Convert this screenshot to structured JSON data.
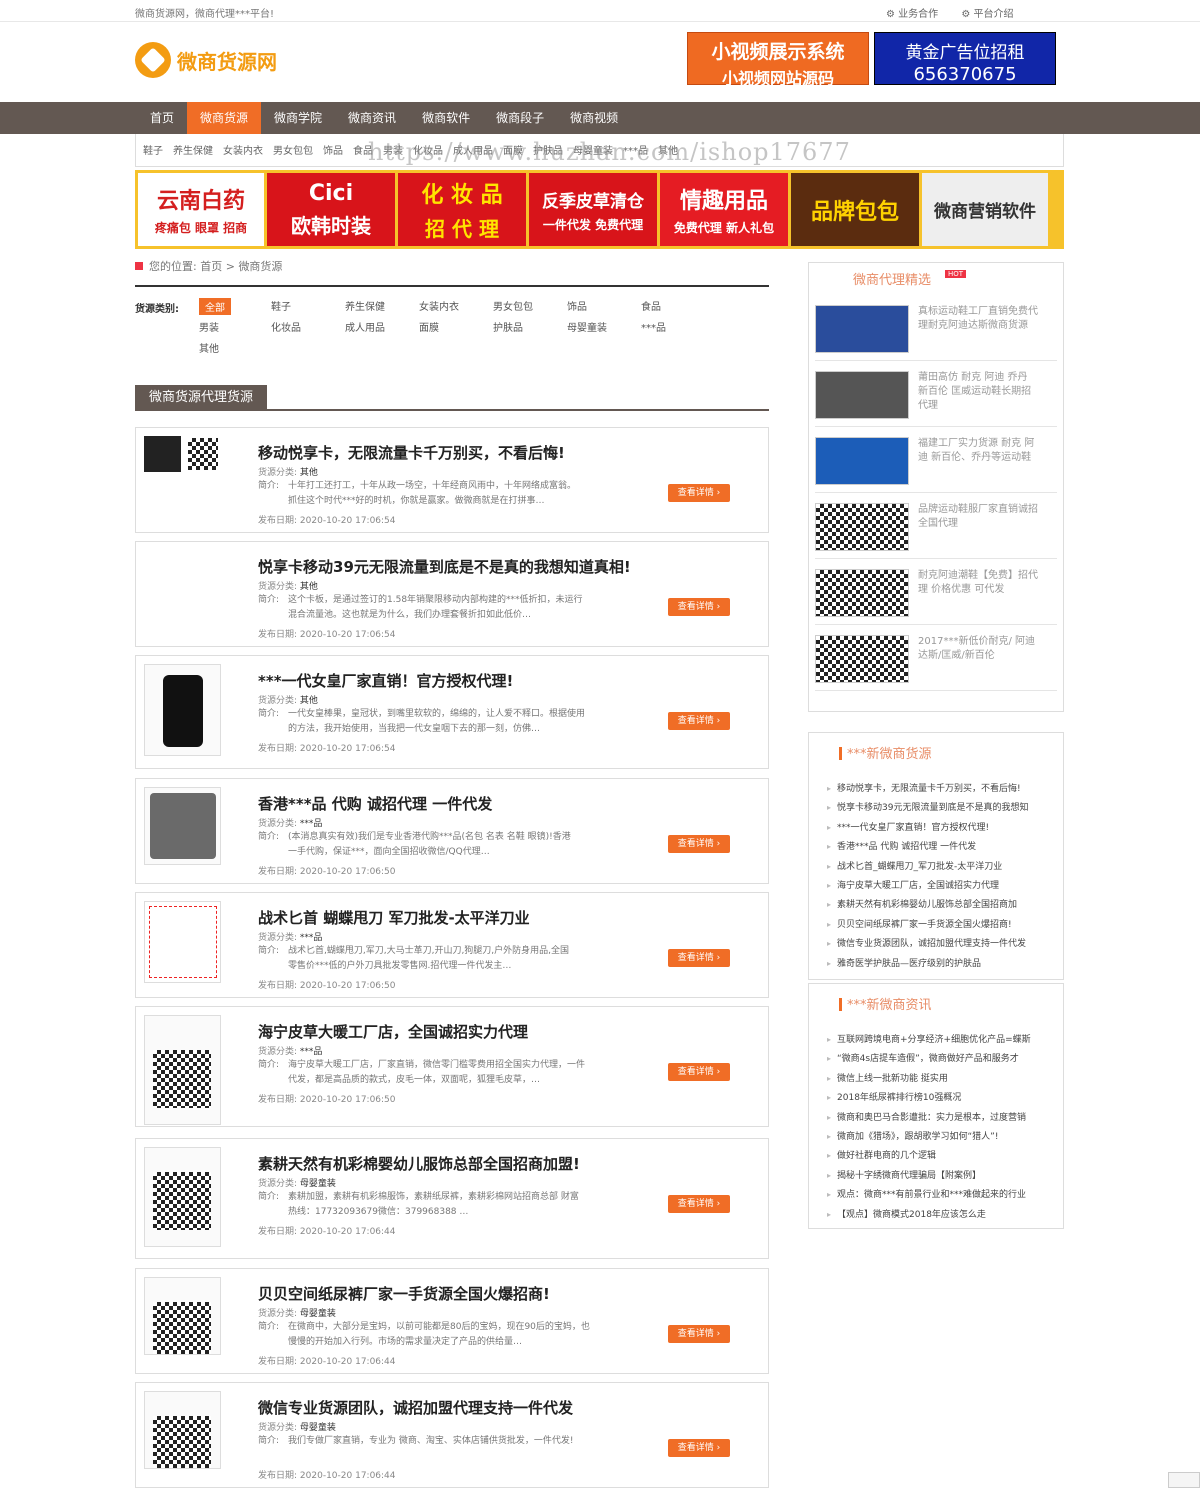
{
  "topbar": {
    "slogan": "微商货源网，微商代理***平台!",
    "links": [
      "业务合作",
      "平台介绍"
    ]
  },
  "logo": {
    "text": "微商货源网"
  },
  "header_banners": {
    "b1": {
      "line1": "小视频展示系统",
      "line2": "小视频网站源码"
    },
    "b2": {
      "line1": "黄金广告位招租",
      "line2": "656370675"
    }
  },
  "nav": {
    "items": [
      "首页",
      "微商货源",
      "微商学院",
      "微商资讯",
      "微商软件",
      "微商段子",
      "微商视频"
    ],
    "active_index": 1
  },
  "subnav": {
    "items": [
      "鞋子",
      "养生保健",
      "女装内衣",
      "男女包包",
      "饰品",
      "食品",
      "男装",
      "化妆品",
      "成人用品",
      "面膜",
      "护肤品",
      "母婴童装",
      "***品",
      "其他"
    ]
  },
  "watermark": "https://www.huzhan.com/ishop17677",
  "ads": [
    {
      "l1": "云南白药",
      "l2": "疼痛包 眼罩 招商",
      "bg": "#ffffff",
      "fg": "#d41f1f",
      "w": 126
    },
    {
      "l1": "Cici",
      "l2": "欧韩时装",
      "bg": "#d8141a",
      "fg": "#ffffff",
      "w": 128
    },
    {
      "l1": "化 妆 品",
      "l2": "招 代 理",
      "bg": "#d8141a",
      "fg": "#ffe400",
      "w": 128
    },
    {
      "l1": "反季皮草清仓",
      "l2": "一件代发 免费代理",
      "bg": "#d8141a",
      "fg": "#ffffff",
      "w": 128
    },
    {
      "l1": "情趣用品",
      "l2": "免费代理 新人礼包",
      "bg": "#e51c23",
      "fg": "#ffffff",
      "w": 128
    },
    {
      "l1": "品牌包包",
      "l2": "",
      "bg": "#5b2c0f",
      "fg": "#ffd200",
      "w": 128
    },
    {
      "l1": "微商营销软件",
      "l2": "",
      "bg": "#eeeeee",
      "fg": "#333333",
      "w": 126
    }
  ],
  "breadcrumb": {
    "prefix": "您的位置:",
    "home": "首页",
    "sep": ">",
    "current": "微商货源"
  },
  "categories": {
    "label": "货源类别:",
    "items": [
      "全部",
      "鞋子",
      "养生保健",
      "女装内衣",
      "男女包包",
      "饰品",
      "食品",
      "男装",
      "化妆品",
      "成人用品",
      "面膜",
      "护肤品",
      "母婴童装",
      "***品",
      "其他"
    ]
  },
  "section_title": "微商货源代理货源",
  "labels": {
    "cat": "货源分类:",
    "desc": "简介:",
    "date": "发布日期:",
    "detail": "查看详情 ›"
  },
  "listings": [
    {
      "title": "移动悦享卡，无限流量卡千万别买，不看后悔!",
      "cat": "其他",
      "d1": "十年打工还打工，十年从政一场空，十年经商风雨中，十年网络成富翁。",
      "d2": "抓住这个时代***好的时机，你就是赢家。做微商就是在打拼事…",
      "date": "2020-10-20 17:06:54"
    },
    {
      "title": "悦享卡移动39元无限流量到底是不是真的我想知道真相!",
      "cat": "其他",
      "d1": "这个卡板，是通过签订的1.58年销聚限移动内部构建的***低折扣，未运行",
      "d2": "混合流量池。这也就是为什么，我们办理套餐折扣如此低价…",
      "date": "2020-10-20 17:06:54"
    },
    {
      "title": "***一代女皇厂家直销！官方授权代理!",
      "cat": "其他",
      "d1": "一代女皇棒果，皇冠状，到嘴里软软的，绵绵的，让人爱不释口。根据使用",
      "d2": "的方法，我开始使用，当我把一代女皇咽下去的那一刻，仿佛…",
      "date": "2020-10-20 17:06:54"
    },
    {
      "title": "香港***品 代购 诚招代理 一件代发",
      "cat": "***品",
      "d1": "(本消息真实有效)我们是专业香港代购***品(名包 名表 名鞋 眼镜)!香港",
      "d2": "一手代购，保证***，面向全国招收微信/QQ代理…",
      "date": "2020-10-20 17:06:50"
    },
    {
      "title": "战术匕首 蝴蝶甩刀 军刀批发-太平洋刀业",
      "cat": "***品",
      "d1": "战术匕首,蝴蝶甩刀,军刀,大马士革刀,开山刀,狗腿刀,户外防身用品,全国",
      "d2": "零售价***低的户外刀具批发零售网.招代理一件代发主…",
      "date": "2020-10-20 17:06:50"
    },
    {
      "title": "海宁皮草大暖工厂店，全国诚招实力代理",
      "cat": "***品",
      "d1": "海宁皮草大暖工厂店，厂家直销，微信零门槛零费用招全国实力代理，一件",
      "d2": "代发，都是高品质的款式，皮毛一体，双面呢，狐狸毛皮草，…",
      "date": "2020-10-20 17:06:50"
    },
    {
      "title": "素耕天然有机彩棉婴幼儿服饰总部全国招商加盟!",
      "cat": "母婴童装",
      "d1": "素耕加盟，素耕有机彩棉服饰，素耕纸尿裤，素耕彩棉网站招商总部 财富",
      "d2": "热线：17732093679微信：379968388 …",
      "date": "2020-10-20 17:06:44"
    },
    {
      "title": "贝贝空间纸尿裤厂家一手货源全国火爆招商!",
      "cat": "母婴童装",
      "d1": "在微商中，大部分是宝妈，以前可能都是80后的宝妈，现在90后的宝妈，也",
      "d2": "慢慢的开始加入行列。市场的需求量决定了产品的供给量…",
      "date": "2020-10-20 17:06:44"
    },
    {
      "title": "微信专业货源团队，诚招加盟代理支持一件代发",
      "cat": "母婴童装",
      "d1": "我们专做厂家直销，专业为 微商、淘宝、实体店铺供货批发，一件代发!",
      "d2": "",
      "date": "2020-10-20 17:06:44"
    }
  ],
  "sidebar_pick": {
    "title": "微商代理精选",
    "hot": "HOT",
    "items": [
      "真标运动鞋工厂直销免费代理耐克阿迪达斯微商货源",
      "莆田高仿 耐克 阿迪 乔丹 新百伦 匡威运动鞋长期招代理",
      "福建工厂实力货源 耐克 阿迪 新百伦、乔丹等运动鞋",
      "品牌运动鞋服厂家直销诚招全国代理",
      "耐克阿迪潮鞋【免费】招代理 价格优惠 可代发",
      "2017***新低价耐克/ 阿迪达斯/匡威/新百伦"
    ]
  },
  "sidebar_new_goods": {
    "title": "***新微商货源",
    "items": [
      "移动悦享卡，无限流量卡千万别买，不看后悔!",
      "悦享卡移动39元无限流量到底是不是真的我想知",
      "***一代女皇厂家直销！官方授权代理!",
      "香港***品 代购 诚招代理 一件代发",
      "战术匕首_蝴蝶甩刀_军刀批发-太平洋刀业",
      "海宁皮草大暖工厂店，全国诚招实力代理",
      "素耕天然有机彩棉婴幼儿服饰总部全国招商加",
      "贝贝空间纸尿裤厂家一手货源全国火爆招商!",
      "微信专业货源团队，诚招加盟代理支持一件代发",
      "雅奇医学护肤品—医疗级别的护肤品"
    ]
  },
  "sidebar_news": {
    "title": "***新微商资讯",
    "items": [
      "互联网跨境电商+分享经济+细胞优化产品=蝶斯",
      "“微商4s店提车造假”，微商做好产品和服务才",
      "微信上线一批新功能 挺实用",
      "2018年纸尿裤排行榜10强概况",
      "微商和奥巴马合影遭批：实力是根本，过度营销",
      "微商加《猎场》，跟胡歌学习如何“猎人”!",
      "做好社群电商的几个逻辑",
      "揭秘十字绣微商代理骗局【附案例】",
      "观点：微商***有前景行业和***难做起来的行业",
      "【观点】微商模式2018年应该怎么走"
    ]
  }
}
